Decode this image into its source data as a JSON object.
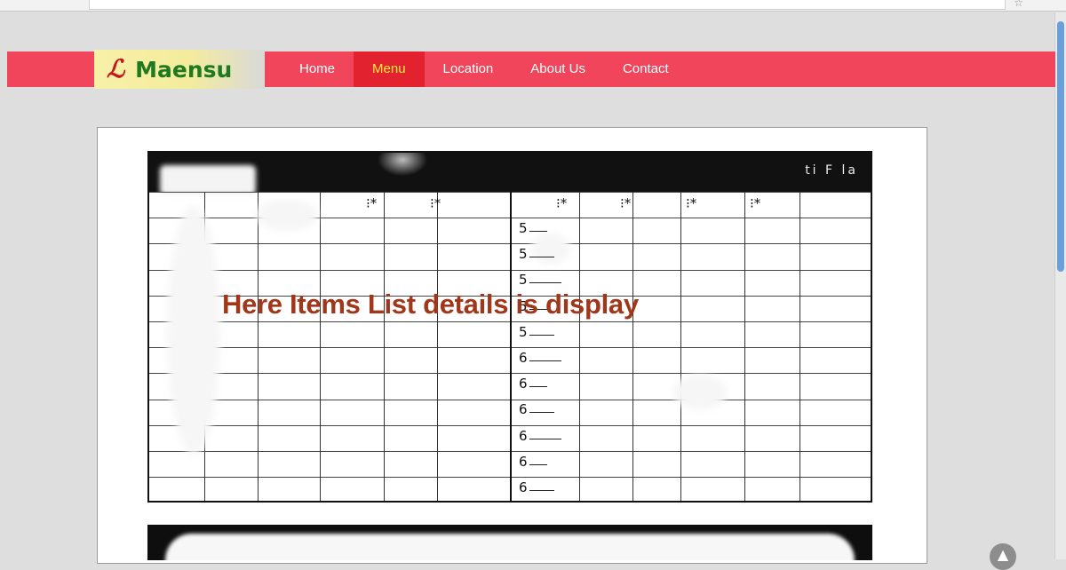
{
  "site": {
    "logo_mark": "ℒ",
    "logo_text": "Maensu"
  },
  "nav": {
    "items": [
      {
        "label": "Home",
        "active": false
      },
      {
        "label": "Menu",
        "active": true
      },
      {
        "label": "Location",
        "active": false
      },
      {
        "label": "About Us",
        "active": false
      },
      {
        "label": "Contact",
        "active": false
      }
    ]
  },
  "content": {
    "overlay_caption": "Here Items List details is display",
    "row_numbers_right": [
      "5",
      "5",
      "5",
      "5",
      "5",
      "6",
      "6",
      "6",
      "6",
      "6",
      "6"
    ],
    "header_marks": [
      "⁝*",
      "⁝*",
      "⁝*",
      "⁝*",
      "⁝*",
      "⁝*"
    ]
  },
  "colors": {
    "navbar": "#f0455a",
    "nav_active": "#e3222f",
    "nav_active_text": "#ffeb3b",
    "logo_mark": "#c0181c",
    "logo_text": "#1f7a1f",
    "overlay_text": "#a0361a",
    "scrollbar_thumb": "#6a9fd8"
  },
  "icons": {
    "scroll_top": "arrow-up-icon",
    "bookmark": "star-icon"
  }
}
